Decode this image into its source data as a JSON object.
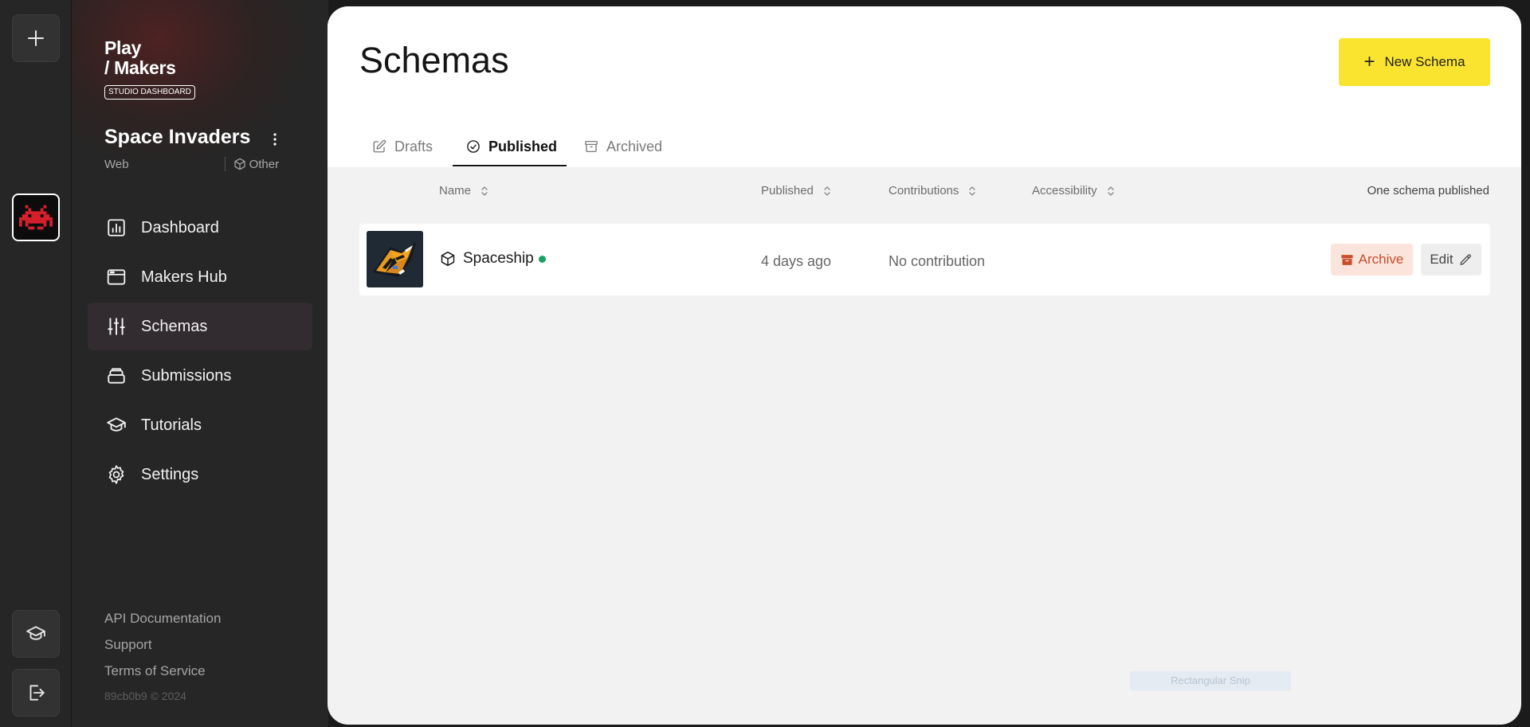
{
  "rail": {
    "add_label": "+",
    "game_icon": "space-invader-icon",
    "tutorials_icon": "graduation-cap-icon",
    "logout_icon": "logout-icon"
  },
  "sidebar": {
    "logo_line1": "Play",
    "logo_line2": "/ Makers",
    "logo_badge": "STUDIO DASHBOARD",
    "project": {
      "title": "Space Invaders",
      "platform": "Web",
      "category": "Other"
    },
    "nav": [
      {
        "label": "Dashboard",
        "icon": "chart-bars-icon"
      },
      {
        "label": "Makers Hub",
        "icon": "browser-window-icon"
      },
      {
        "label": "Schemas",
        "icon": "sliders-icon",
        "active": true
      },
      {
        "label": "Submissions",
        "icon": "stack-icon"
      },
      {
        "label": "Tutorials",
        "icon": "graduation-cap-icon"
      },
      {
        "label": "Settings",
        "icon": "gear-icon"
      }
    ],
    "footer": {
      "api_docs": "API Documentation",
      "support": "Support",
      "terms": "Terms of Service",
      "version": "89cb0b9 © 2024"
    }
  },
  "main": {
    "title": "Schemas",
    "new_button": "New Schema",
    "tabs": [
      {
        "label": "Drafts",
        "icon": "pencil-square-icon"
      },
      {
        "label": "Published",
        "icon": "check-circle-icon",
        "active": true
      },
      {
        "label": "Archived",
        "icon": "archive-box-icon"
      }
    ],
    "columns": [
      "Name",
      "Published",
      "Contributions",
      "Accessibility"
    ],
    "count_text": "One schema published",
    "rows": [
      {
        "name": "Spaceship",
        "status_color": "#1aa160",
        "published": "4 days ago",
        "contributions": "No contribution",
        "accessibility": "",
        "archive_label": "Archive",
        "edit_label": "Edit"
      }
    ]
  },
  "overlay": {
    "snip_label": "Rectangular Snip"
  },
  "colors": {
    "accent": "#fbe42f",
    "archive_text": "#c84e2a",
    "archive_bg": "#fbe4dc",
    "sidebar_bg": "#262626"
  }
}
